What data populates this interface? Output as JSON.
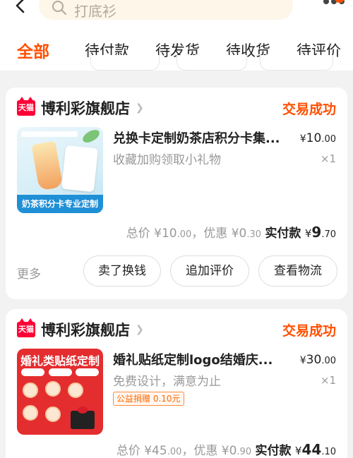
{
  "header": {
    "search_placeholder": "打底衫"
  },
  "tabs": [
    {
      "label": "全部",
      "active": true
    },
    {
      "label": "待付款",
      "active": false
    },
    {
      "label": "待发货",
      "active": false
    },
    {
      "label": "待收货",
      "active": false
    },
    {
      "label": "待评价",
      "active": false
    }
  ],
  "orders": [
    {
      "shop_badge": "天猫",
      "shop_name": "博利彩旗舰店",
      "status": "交易成功",
      "product_title": "兑换卡定制奶茶店积分卡集...",
      "product_subtitle": "收藏加购领取小礼物",
      "product_image_banner": "奶茶积分卡专业定制",
      "price_currency": "¥",
      "price_integer": "10",
      "price_decimal": ".00",
      "quantity": "×1",
      "total_label": "总价",
      "total_integer": "¥10",
      "total_decimal": ".00",
      "discount_label": "，优惠",
      "discount_integer": "¥0",
      "discount_decimal": ".30",
      "paid_label": "实付款",
      "paid_currency": "¥",
      "paid_integer": "9",
      "paid_decimal": ".70",
      "more_label": "更多",
      "actions": [
        "卖了换钱",
        "追加评价",
        "查看物流"
      ]
    },
    {
      "shop_badge": "天猫",
      "shop_name": "博利彩旗舰店",
      "status": "交易成功",
      "product_title": "婚礼贴纸定制logo结婚庆...",
      "product_subtitle": "免费设计，满意为止",
      "product_image_title": "婚礼类贴纸定制",
      "charity_tag": "公益捐赠 0.10元",
      "price_currency": "¥",
      "price_integer": "30",
      "price_decimal": ".00",
      "quantity": "×1",
      "total_label": "总价",
      "total_integer": "¥45",
      "total_decimal": ".00",
      "discount_label": "，优惠",
      "discount_integer": "¥0",
      "discount_decimal": ".90",
      "paid_label": "实付款",
      "paid_currency": "¥",
      "paid_integer": "44",
      "paid_decimal": ".10"
    }
  ],
  "colors": {
    "accent": "#ff5000",
    "tmall_red": "#ff0036",
    "muted_text": "#999999"
  }
}
